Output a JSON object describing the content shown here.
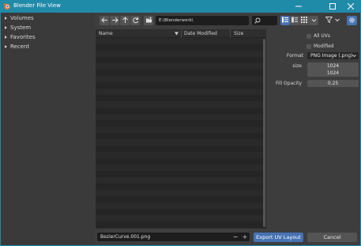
{
  "window": {
    "title": "Blender File View",
    "controls": {
      "minimize": "minimize-icon",
      "maximize": "maximize-icon",
      "close": "close-icon"
    },
    "accent_color": "#208aa9"
  },
  "sidebar": {
    "items": [
      {
        "label": "Volumes"
      },
      {
        "label": "System"
      },
      {
        "label": "Favorites"
      },
      {
        "label": "Recent"
      }
    ]
  },
  "toolbar": {
    "path": "E:\\Blenderwork\\",
    "search_placeholder": "",
    "icons": [
      "back-icon",
      "forward-icon",
      "parent-dir-icon",
      "refresh-icon",
      "new-folder-icon",
      "search-icon",
      "list-view-icon",
      "thumbnail-view-icon",
      "filter-icon",
      "settings-icon"
    ]
  },
  "file_list": {
    "columns": [
      "Name",
      "Date Modified",
      "Size"
    ]
  },
  "options": {
    "all_uvs_label": "All UVs",
    "all_uvs_checked": false,
    "modified_label": "Modified",
    "modified_checked": false,
    "format_label": "Format",
    "format_value": "PNG Image (.png)",
    "size_label": "size",
    "size_x": "1024",
    "size_y": "1024",
    "fill_opacity_label": "Fill Opacity",
    "fill_opacity_value": "0.25"
  },
  "bottom": {
    "filename": "BezierCurve.001.png",
    "decrement": "−",
    "increment": "+",
    "export_label": "Export UV Layout",
    "cancel_label": "Cancel",
    "export_color": "#4772b3"
  }
}
